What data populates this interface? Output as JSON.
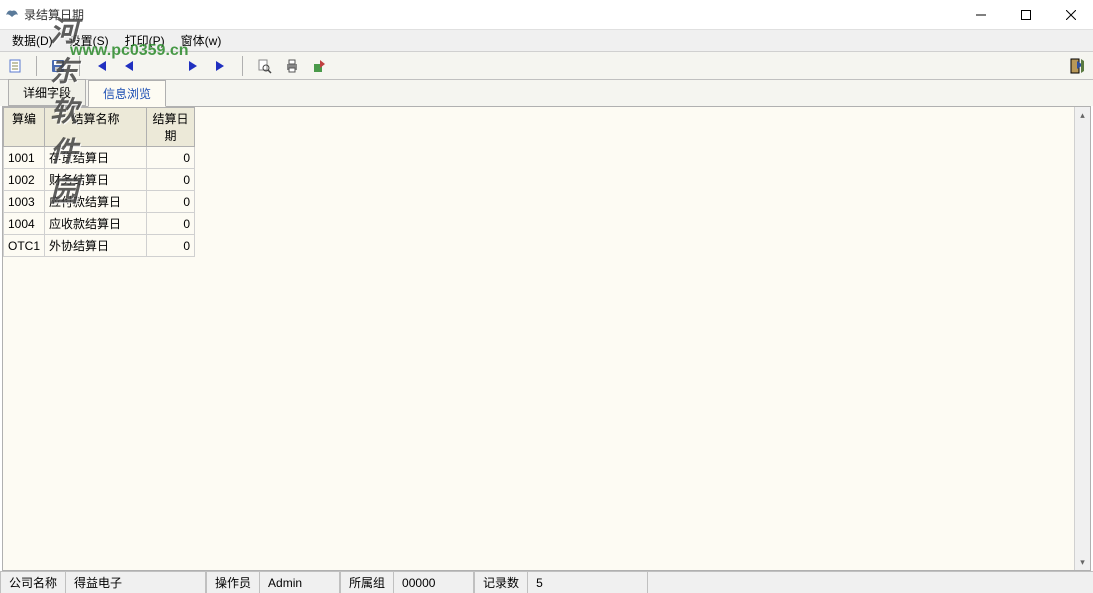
{
  "window": {
    "title": "录结算日期"
  },
  "menu": {
    "data": "数据(D)",
    "settings": "设置(S)",
    "print": "打印(P)",
    "window": "窗体(w)"
  },
  "watermark": {
    "name": "河东软件园",
    "url": "www.pc0359.cn"
  },
  "tabs": {
    "detail": "详细字段",
    "browse": "信息浏览"
  },
  "grid": {
    "headers": {
      "code": "算编",
      "name": "结算名称",
      "date": "结算日期"
    },
    "rows": [
      {
        "code": "1001",
        "name": "存货结算日",
        "date": "0"
      },
      {
        "code": "1002",
        "name": "财务结算日",
        "date": "0"
      },
      {
        "code": "1003",
        "name": "应付款结算日",
        "date": "0"
      },
      {
        "code": "1004",
        "name": "应收款结算日",
        "date": "0"
      },
      {
        "code": "OTC1",
        "name": "外协结算日",
        "date": "0"
      }
    ]
  },
  "status": {
    "company_label": "公司名称",
    "company": "得益电子",
    "operator_label": "操作员",
    "operator": "Admin",
    "group_label": "所属组",
    "group": "00000",
    "count_label": "记录数",
    "count": "5"
  }
}
